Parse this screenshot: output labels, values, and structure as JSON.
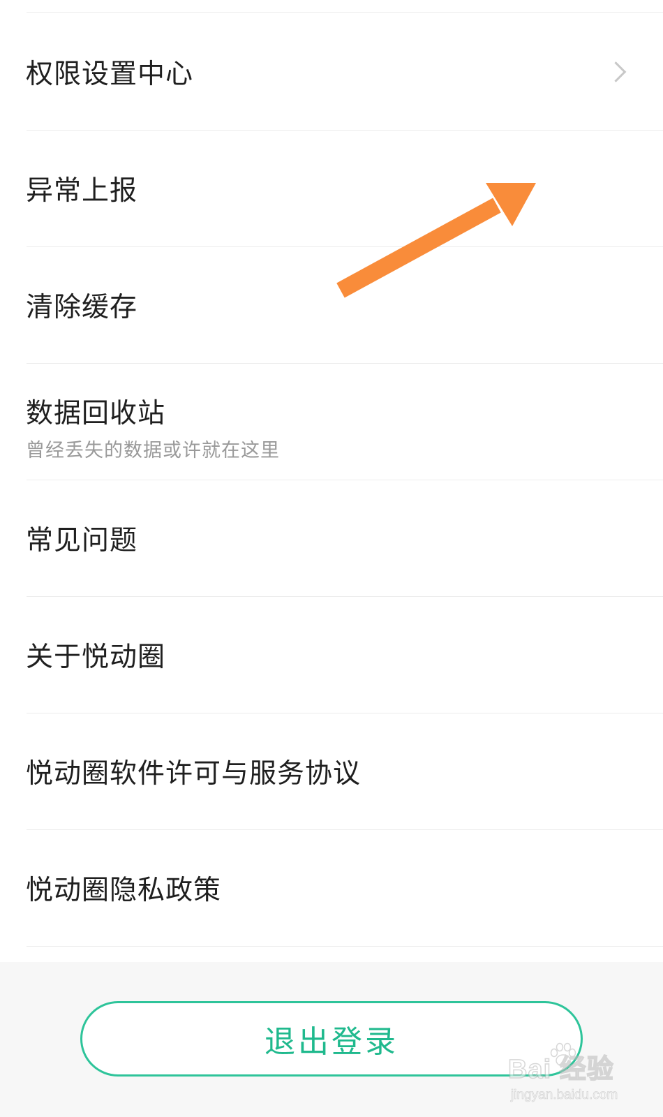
{
  "settings_list": {
    "items": [
      {
        "label": "权限设置中心",
        "has_chevron": true
      },
      {
        "label": "异常上报"
      },
      {
        "label": "清除缓存"
      },
      {
        "label": "数据回收站",
        "sublabel": "曾经丢失的数据或许就在这里"
      },
      {
        "label": "常见问题"
      },
      {
        "label": "关于悦动圈"
      },
      {
        "label": "悦动圈软件许可与服务协议"
      },
      {
        "label": "悦动圈隐私政策"
      }
    ]
  },
  "footer": {
    "logout_label": "退出登录"
  },
  "annotation": {
    "arrow_color": "#f98c3a",
    "icon": "arrow-annotation-icon"
  },
  "watermark": {
    "brand": "Bai 经验",
    "url": "jingyan.baidu.com",
    "icon": "paw-icon"
  },
  "colors": {
    "accent": "#1fb98d",
    "divider": "#ececec",
    "text": "#1f1f1f",
    "subtext": "#9a9a9a"
  }
}
